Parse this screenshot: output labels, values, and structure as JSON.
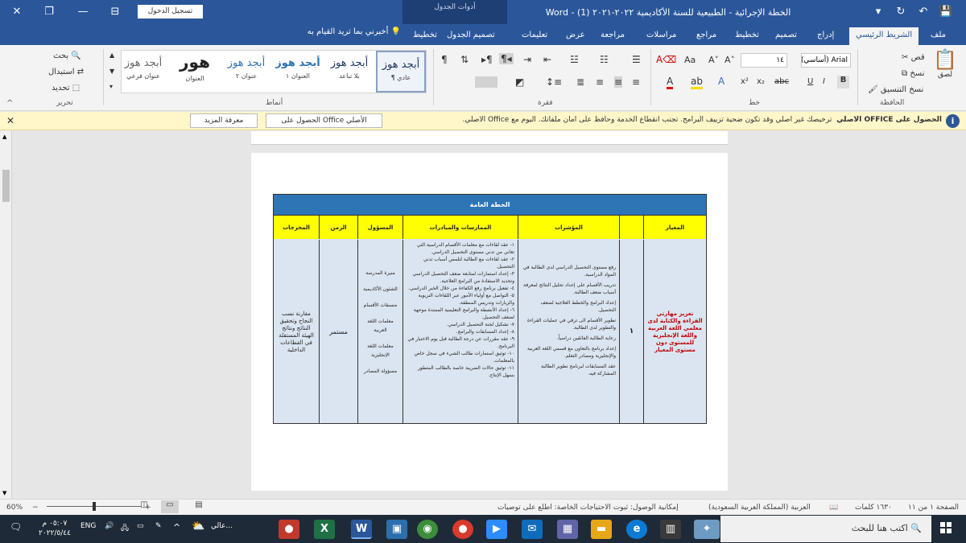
{
  "window": {
    "title": "الخطة الإجرائية - الطبيعية للسنة الأكاديمية ٢٠٢٢-٢٠٢١ (1) - Word",
    "signin": "تسجيل الدخول",
    "contextual": "أدوات الجدول",
    "controls": {
      "close": "✕",
      "restore": "❐",
      "minimize": "—",
      "ribbon_options": "⊟"
    },
    "qat": {
      "save": "💾",
      "undo": "↶",
      "redo": "↻",
      "customize": "▾"
    }
  },
  "tabs": [
    "ملف",
    "الشريط الرئيسي",
    "إدراج",
    "تصميم",
    "تخطيط",
    "مراجع",
    "مراسلات",
    "مراجعة",
    "عرض",
    "تعليمات",
    "تصميم الجدول",
    "تخطيط"
  ],
  "tell_me": "أخبرني بما تريد القيام به",
  "ribbon": {
    "groups": [
      "الحافظة",
      "خط",
      "فقرة",
      "أنماط",
      "تحرير"
    ],
    "clipboard": {
      "paste": "لصق",
      "cut": "قص",
      "copy": "نسخ",
      "format_painter": "نسخ التنسيق"
    },
    "font": {
      "name": "Arial (أساسي)",
      "size": "١٤",
      "case": "Aa",
      "bold": "B",
      "italic": "I",
      "underline": "U",
      "strike": "abc",
      "sub": "x₂",
      "sup": "x²"
    },
    "styles": [
      {
        "sample": "أبجد هوز",
        "name": "¶ عادي"
      },
      {
        "sample": "أبجد هوز",
        "name": "بلا تباعد"
      },
      {
        "sample": "أبجد هوز",
        "name": "العنوان ١"
      },
      {
        "sample": "أبجد هوز",
        "name": "عنوان ٢"
      },
      {
        "sample": "هور",
        "name": "العنوان"
      },
      {
        "sample": "أبجد هوز",
        "name": "عنوان فرعي"
      }
    ],
    "editing": {
      "find": "بحث",
      "replace": "استبدال",
      "select": "تحديد"
    }
  },
  "message_bar": {
    "title": "الحصول على OFFICE الأصلي",
    "text": "ترخيصك غير أصلي وقد تكون ضحية تزييف البرامج. تجنب انقطاع الخدمة وحافظ على أمان ملفاتك. اليوم مع Office الأصلي.",
    "btn_get": "الحصول على Office الأصلي",
    "btn_more": "معرفة المزيد"
  },
  "document": {
    "table_title": "الخطة العامة",
    "headers": [
      "المعيار",
      "",
      "المؤشرات",
      "الممارسات والمبادرات",
      "المسؤول",
      "الزمن",
      "المخرجات"
    ],
    "objective": "تعزيز مهارتي القراءة والكتابة لدى معلمي اللغة العربية واللغة الإنجليزية للمستوى دون مستوى المعيار",
    "criterion": "١",
    "indicators": [
      "رفع مستوى التحصيل الدراسي لدى الطالبة في المواد الدراسية.",
      "تدريب الأقسام على إعداد تحليل النتائج لمعرفة أسباب ضعف الطالبة.",
      "إعداد البرامج والخطط العلاجية لضعف التحصيل.",
      "تطوير الأقسام الى ترقي في عمليات القراءة والتطوير لدى الطالبة.",
      "رعاية الطالبة الفائقين دراسياً.",
      "إعداد برنامج بالتعاون مع قسمي اللغة العربية والإنجليزية ومصادر التعلم.",
      "عقد المسابقات لبرنامج تطوير الطالبة المشاركة فيه."
    ],
    "practices": [
      "١- عقد لقاءات مع معلمات الأقسام الدراسية التي تعاني من تدني مستوى التحصيل الدراسي.",
      "٢- عقد لقاءات مع الطالبة لتلمس أسباب تدني التحصيل.",
      "٣- إعداد استمارات لمتابعة ضعف التحصيل الدراسي وتحديد الاستفادة من البرامج العلاجية.",
      "٤- تفعيل برنامج رفع الكفاءة من خلال الخبر الدراسي.",
      "٥- التواصل مع أولياء الأمور عبر اللقاءات التربوية والزيارات وتدريس المنطقة.",
      "٦- إعداد الأنشطة والبرامج التعليمية الممتدة موجهة لضعف التحصيل.",
      "٧- تشكيل لجنة التحصيل الدراسي.",
      "٨- إعداد المسابقات والبرامج.",
      "٩- عقد مقررات عن درجة الطالبة قبل يوم الاختبار في البرنامج.",
      "١٠- توثيق استمارات طالب الشيء في سجل خاص بالمعلمات.",
      "١١- توثيق حالات الضريبة خاصة بالطالب المتطور بسهل الإنتاج."
    ],
    "responsible": [
      "منيرة المدرسة",
      "الشئون الأكاديمية",
      "منسقات الأقسام",
      "معلمات اللغة العربية",
      "معلمات اللغة الإنجليزية",
      "مسؤولة المصادر"
    ],
    "time": "مستمر",
    "outputs": "مقارنة نسب النجاح وتحقيق النتائج ونتائج الهيئة المستقلة في القطاعات الداخلية"
  },
  "status": {
    "page": "الصفحة ١ من ١١",
    "words": "١٦٣٠ كلمات",
    "language": "العربية (المملكة العربية السعودية)",
    "accessibility": "إمكانية الوصول: ثبوت الاحتياجات الخاصة: اطلع على توصيات",
    "zoom": "60%"
  },
  "taskbar": {
    "search": "اكتب هنا للبحث",
    "time": "٠٥:٠٧ م",
    "date": "٢٠٢٢/٥/٤٤",
    "lang": "ENG",
    "weather": "عالي..."
  }
}
